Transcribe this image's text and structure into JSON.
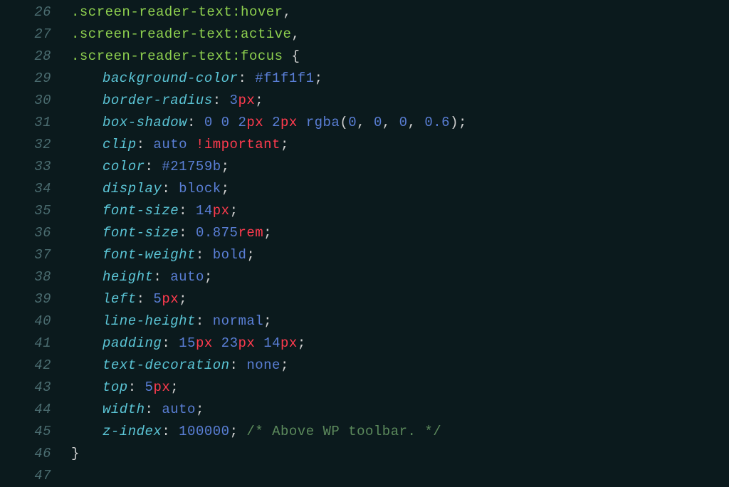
{
  "lineStart": 26,
  "lines": {
    "26": {
      "selector": ".screen-reader-text",
      "pseudo": ":hover",
      "trail": ","
    },
    "27": {
      "selector": ".screen-reader-text",
      "pseudo": ":active",
      "trail": ","
    },
    "28": {
      "selector": ".screen-reader-text",
      "pseudo": ":focus",
      "trail": " {"
    },
    "29": {
      "prop": "background-color",
      "hex": "#f1f1f1"
    },
    "30": {
      "prop": "border-radius",
      "num": "3",
      "unit": "px"
    },
    "31": {
      "prop": "box-shadow",
      "pre": "0 0 ",
      "n1": "2",
      "u1": "px",
      "n2": "2",
      "u2": "px",
      "func": "rgba",
      "args": [
        "0",
        "0",
        "0",
        "0.6"
      ]
    },
    "32": {
      "prop": "clip",
      "val": "auto",
      "important": "!important"
    },
    "33": {
      "prop": "color",
      "hex": "#21759b"
    },
    "34": {
      "prop": "display",
      "val": "block"
    },
    "35": {
      "prop": "font-size",
      "num": "14",
      "unit": "px"
    },
    "36": {
      "prop": "font-size",
      "num": "0.875",
      "unit": "rem"
    },
    "37": {
      "prop": "font-weight",
      "val": "bold"
    },
    "38": {
      "prop": "height",
      "val": "auto"
    },
    "39": {
      "prop": "left",
      "num": "5",
      "unit": "px"
    },
    "40": {
      "prop": "line-height",
      "val": "normal"
    },
    "41": {
      "prop": "padding",
      "n1": "15",
      "u1": "px",
      "n2": "23",
      "u2": "px",
      "n3": "14",
      "u3": "px"
    },
    "42": {
      "prop": "text-decoration",
      "val": "none"
    },
    "43": {
      "prop": "top",
      "num": "5",
      "unit": "px"
    },
    "44": {
      "prop": "width",
      "val": "auto"
    },
    "45": {
      "prop": "z-index",
      "numonly": "100000",
      "comment": "/* Above WP toolbar. */"
    },
    "46": {
      "close": "}"
    }
  }
}
